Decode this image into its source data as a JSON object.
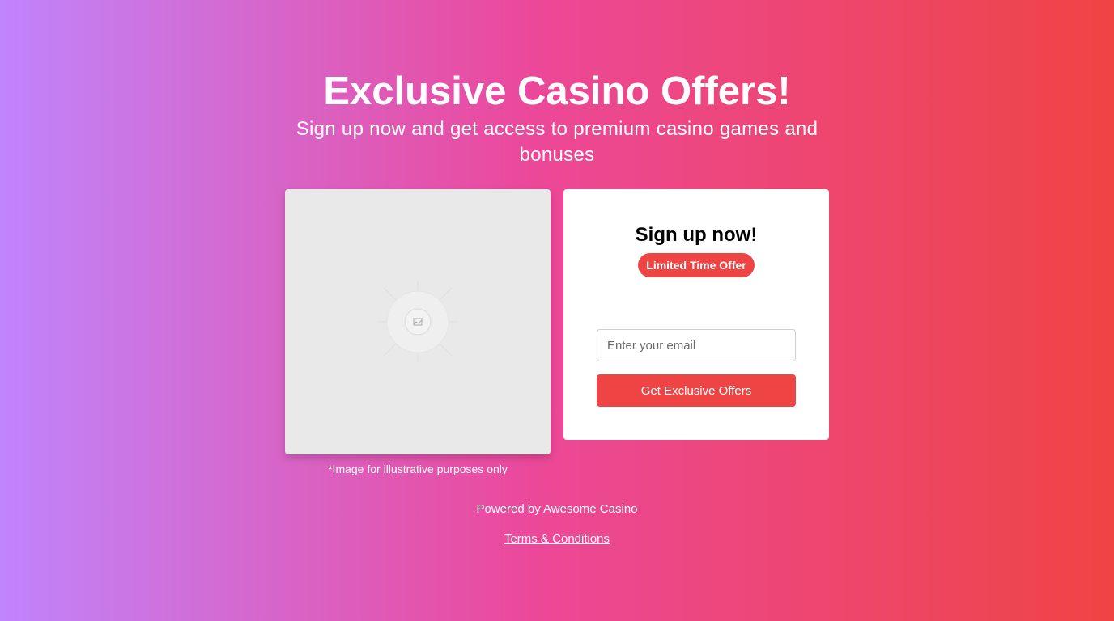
{
  "hero": {
    "title": "Exclusive Casino Offers!",
    "subtitle": "Sign up now and get access to premium casino games and bonuses"
  },
  "image_panel": {
    "placeholder_icon": "image-icon",
    "caption": "*Image for illustrative purposes only"
  },
  "signup": {
    "title": "Sign up now!",
    "badge": "Limited Time Offer",
    "email_placeholder": "Enter your email",
    "email_value": "",
    "button_label": "Get Exclusive Offers"
  },
  "footer": {
    "powered_by": "Powered by Awesome Casino",
    "terms_link": "Terms & Conditions"
  },
  "colors": {
    "accent": "#ef4444",
    "gradient_start": "#c084fc",
    "gradient_mid": "#ec4899",
    "gradient_end": "#ef4444"
  }
}
